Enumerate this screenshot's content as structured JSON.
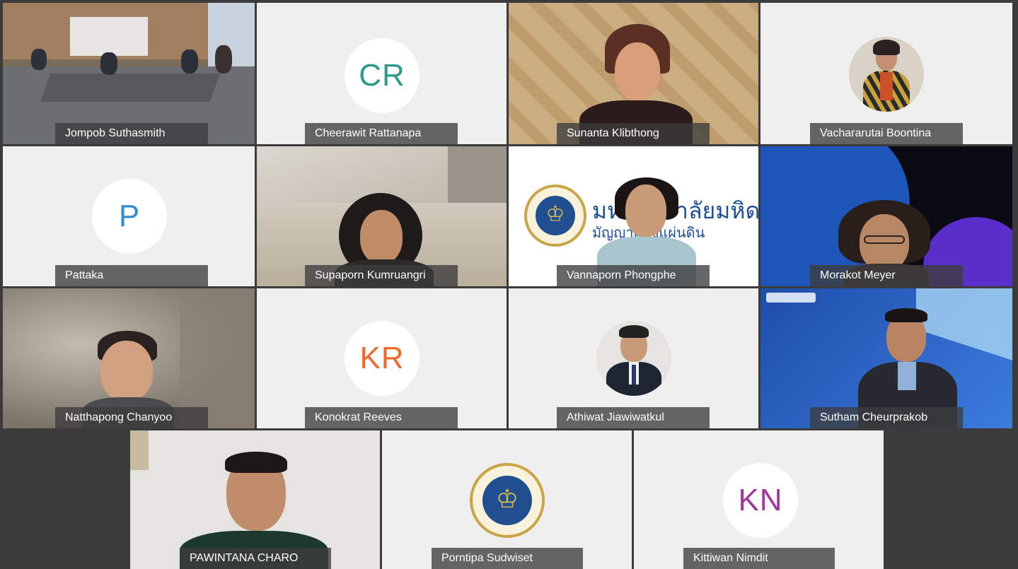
{
  "window_title": "",
  "colors": {
    "cr_initials": "#2e9a8a",
    "p_initials": "#2f8fd2",
    "kr_initials": "#ea6b31",
    "kn_initials": "#a0369c",
    "mahidol_blue": "#1f4f8f",
    "mahidol_gold": "#c9a54a"
  },
  "participants": [
    {
      "id": "jompob",
      "name": "Jompob Suthasmith",
      "kind": "video",
      "scene": "meeting-room"
    },
    {
      "id": "cheerawit",
      "name": "Cheerawit Rattanapa",
      "kind": "initials",
      "initials": "CR"
    },
    {
      "id": "sunanta",
      "name": "Sunanta Klibthong",
      "kind": "video",
      "scene": "wood-wall"
    },
    {
      "id": "vachararutai",
      "name": "Vachararutai Boontina",
      "kind": "avatar-photo"
    },
    {
      "id": "pattaka",
      "name": "Pattaka",
      "kind": "initials",
      "initials": "P"
    },
    {
      "id": "supaporn",
      "name": "Supaporn Kumruangri",
      "kind": "video",
      "scene": "office"
    },
    {
      "id": "vannaporn",
      "name": "Vannaporn Phongphe",
      "kind": "video",
      "scene": "mahidol-background",
      "background_text_line1": "มหาวิทยาลัยมหิดล",
      "background_text_line2": "มัญญาแห่งแผ่นดิน"
    },
    {
      "id": "morakot",
      "name": "Morakot Meyer",
      "kind": "video",
      "scene": "blue-virtual"
    },
    {
      "id": "natthapong",
      "name": "Natthapong Chanyoo",
      "kind": "video",
      "scene": "blurred-room"
    },
    {
      "id": "konokrat",
      "name": "Konokrat Reeves",
      "kind": "initials",
      "initials": "KR"
    },
    {
      "id": "athiwat",
      "name": "Athiwat Jiawiwatkul",
      "kind": "avatar-photo"
    },
    {
      "id": "sutham",
      "name": "Sutham Cheurprakob",
      "kind": "video",
      "scene": "mahidol-blue"
    },
    {
      "id": "pawintana",
      "name": "PAWINTANA CHARO",
      "kind": "video",
      "scene": "white-wall"
    },
    {
      "id": "porntipa",
      "name": "Porntipa Sudwiset",
      "kind": "avatar-seal"
    },
    {
      "id": "kittiwan",
      "name": "Kittiwan Nimdit",
      "kind": "initials",
      "initials": "KN"
    }
  ]
}
